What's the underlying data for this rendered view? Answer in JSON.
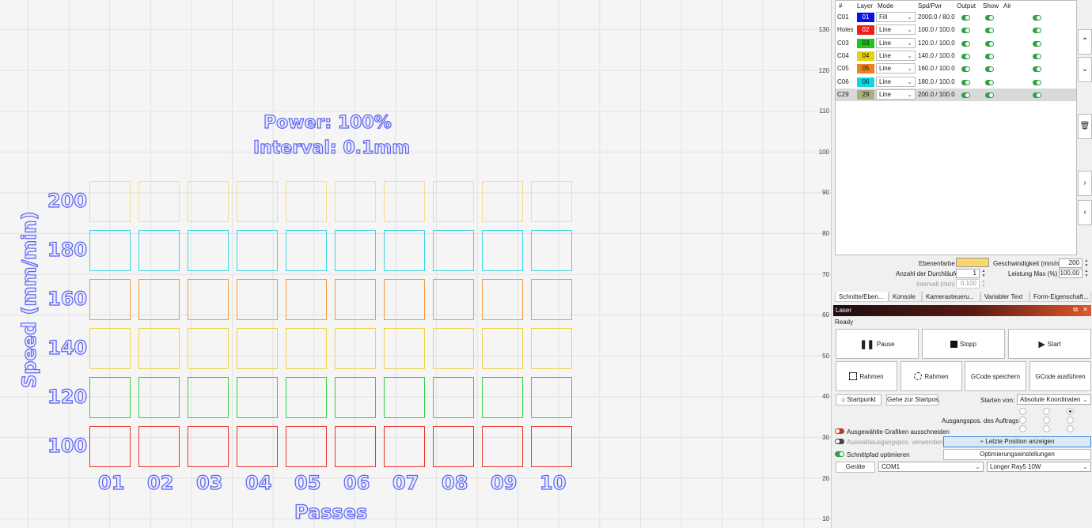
{
  "canvas": {
    "title_power": "Power: 100%",
    "title_interval": "Interval: 0.1mm",
    "y_axis_label": "Speed (mm/min)",
    "x_axis_label": "Passes",
    "speed_labels": [
      "200",
      "180",
      "160",
      "140",
      "120",
      "100"
    ],
    "pass_labels": [
      "01",
      "02",
      "03",
      "04",
      "05",
      "06",
      "07",
      "08",
      "09",
      "10"
    ],
    "row_colors": [
      "#f7dc8a",
      "#3fd5e0",
      "#f59a3c",
      "#f0d24a",
      "#34d04a",
      "#e8352b"
    ],
    "ruler_labels": [
      "130",
      "120",
      "110",
      "100",
      "90",
      "80",
      "70",
      "60",
      "50",
      "40",
      "30",
      "20",
      "10"
    ]
  },
  "layers": {
    "headers": [
      "#",
      "Layer",
      "Mode",
      "Spd/Pwr",
      "Output",
      "Show",
      "Air"
    ],
    "rows": [
      {
        "name": "C01",
        "num": "01",
        "color": "#0b10e8",
        "text_color": "#ffffff",
        "mode": "Fill",
        "spdpwr": "2000.0 / 80.0"
      },
      {
        "name": "Holes",
        "num": "02",
        "color": "#ee1c1c",
        "text_color": "#ffffff",
        "mode": "Line",
        "spdpwr": "100.0 / 100.0"
      },
      {
        "name": "C03",
        "num": "03",
        "color": "#22c21f",
        "text_color": "#111111",
        "mode": "Line",
        "spdpwr": "120.0 / 100.0"
      },
      {
        "name": "C04",
        "num": "04",
        "color": "#e8d20e",
        "text_color": "#111111",
        "mode": "Line",
        "spdpwr": "140.0 / 100.0"
      },
      {
        "name": "C05",
        "num": "05",
        "color": "#f0801c",
        "text_color": "#111111",
        "mode": "Line",
        "spdpwr": "160.0 / 100.0"
      },
      {
        "name": "C06",
        "num": "06",
        "color": "#11d8e0",
        "text_color": "#111111",
        "mode": "Line",
        "spdpwr": "180.0 / 100.0"
      },
      {
        "name": "C29",
        "num": "29",
        "color": "#a8b083",
        "text_color": "#111111",
        "mode": "Line",
        "spdpwr": "200.0 / 100.0"
      }
    ]
  },
  "layer_settings": {
    "ebenenfarbe_label": "Ebenenfarbe",
    "ebenenfarbe_color": "#f9d66e",
    "speed_label": "Geschwindigkeit (mm/m)",
    "speed_value": "200",
    "passes_label": "Anzahl der Durchläufe",
    "passes_value": "1",
    "power_label": "Leistung Max (%)",
    "power_value": "100,00",
    "interval_label": "Intervall (mm)",
    "interval_value": "0.100"
  },
  "tabs": [
    "Schnitte/Eben...",
    "Konsole",
    "Kamerasteueru...",
    "Variabler Text",
    "Form-Eigenschaft..."
  ],
  "laser": {
    "title": "Laser",
    "status": "Ready",
    "pause": "Pause",
    "stop": "Stopp",
    "start": "Start",
    "frame1": "Rahmen",
    "frame2": "Rahmen",
    "save_gcode": "GCode speichern",
    "run_gcode": "GCode ausführen",
    "home": "Startpunkt",
    "goto_origin": "Gehe zur Startpos.",
    "start_from_label": "Starten von:",
    "start_from_value": "Absolute Koordinaten",
    "job_origin_label": "Ausgangspos. des Auftrags",
    "cut_selected": "Ausgewählte Grafiken ausschneiden",
    "use_selection_origin": "Auswahlausgangspos. verwenden",
    "show_last_position": "Letzte Position anzeigen",
    "optimize_path": "Schnittpfad optimieren",
    "optimization_settings": "Optimierungseinstellungen",
    "devices": "Geräte",
    "port": "COM1",
    "device": "Longer Ray5 10W"
  }
}
